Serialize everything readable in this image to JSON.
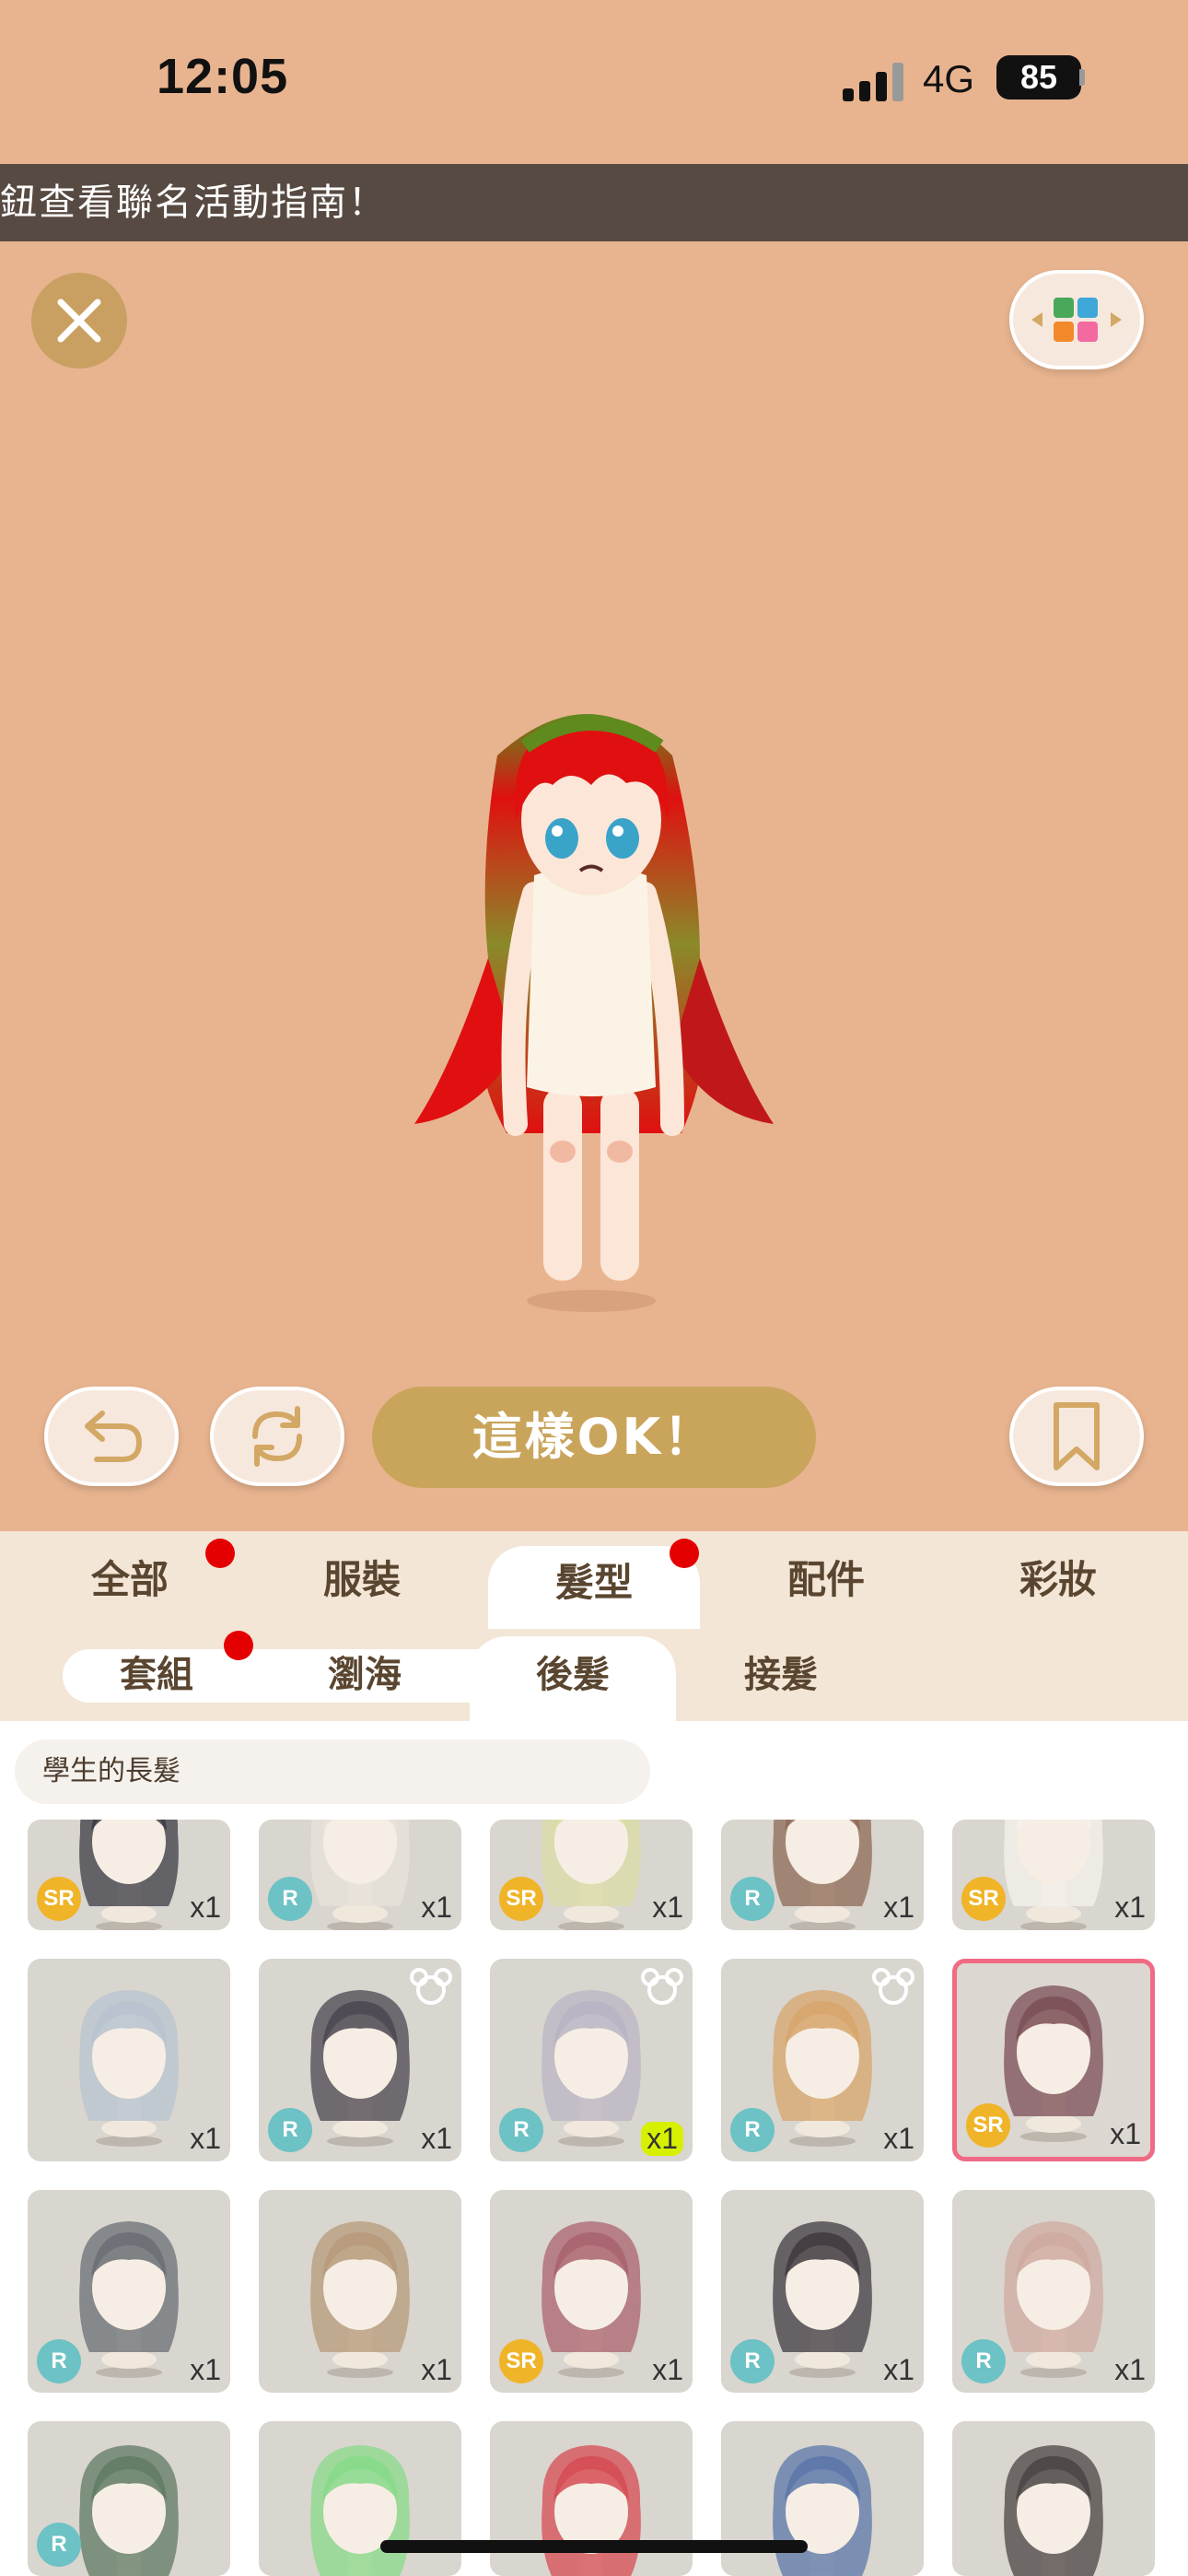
{
  "status_bar": {
    "time": "12:05",
    "network": "4G",
    "battery": "85"
  },
  "banner": {
    "text": "鈕查看聯名活動指南！"
  },
  "actions": {
    "ok_label": "這樣OK！"
  },
  "category_tabs": [
    {
      "label": "全部",
      "dot": true
    },
    {
      "label": "服裝",
      "dot": false
    },
    {
      "label": "髮型",
      "dot": true,
      "active": true
    },
    {
      "label": "配件",
      "dot": false
    },
    {
      "label": "彩妝",
      "dot": false
    }
  ],
  "sub_tabs": [
    {
      "label": "套組",
      "dot": true
    },
    {
      "label": "瀏海",
      "dot": false
    },
    {
      "label": "後髮",
      "dot": false,
      "active": true
    },
    {
      "label": "接髮",
      "dot": false
    }
  ],
  "selected_item_name": "學生的長髮",
  "items": [
    {
      "rarity": "SR",
      "qty": "x1",
      "hair": "#3a3b44"
    },
    {
      "rarity": "R",
      "qty": "x1",
      "hair": "#e7e2da"
    },
    {
      "rarity": "SR",
      "qty": "x1",
      "hair": "#d9dca5"
    },
    {
      "rarity": "R",
      "qty": "x1",
      "hair": "#8e6a56"
    },
    {
      "rarity": "SR",
      "qty": "x1",
      "hair": "#f4f1ec"
    },
    {
      "rarity": "",
      "qty": "x1",
      "hair": "#b7c3d0"
    },
    {
      "rarity": "R",
      "qty": "x1",
      "hair": "#4a4650",
      "bear": true
    },
    {
      "rarity": "R",
      "qty": "x1",
      "hair": "#b9b4c4",
      "bear": true,
      "highlight": true
    },
    {
      "rarity": "R",
      "qty": "x1",
      "hair": "#d7a56b",
      "bear": true
    },
    {
      "rarity": "SR",
      "qty": "x1",
      "hair": "#7a4e55",
      "selected": true
    },
    {
      "rarity": "R",
      "qty": "x1",
      "hair": "#6a6f74"
    },
    {
      "rarity": "",
      "qty": "x1",
      "hair": "#b69a7a"
    },
    {
      "rarity": "SR",
      "qty": "x1",
      "hair": "#a9636d"
    },
    {
      "rarity": "R",
      "qty": "x1",
      "hair": "#3f3a40"
    },
    {
      "rarity": "R",
      "qty": "x1",
      "hair": "#cfa9a0"
    },
    {
      "rarity": "R",
      "qty": "",
      "hair": "#5f7a63"
    },
    {
      "rarity": "",
      "qty": "",
      "hair": "#87d98a"
    },
    {
      "rarity": "",
      "qty": "",
      "hair": "#d64b53"
    },
    {
      "rarity": "",
      "qty": "",
      "hair": "#5b77a8"
    },
    {
      "rarity": "",
      "qty": "",
      "hair": "#4a4444"
    }
  ]
}
